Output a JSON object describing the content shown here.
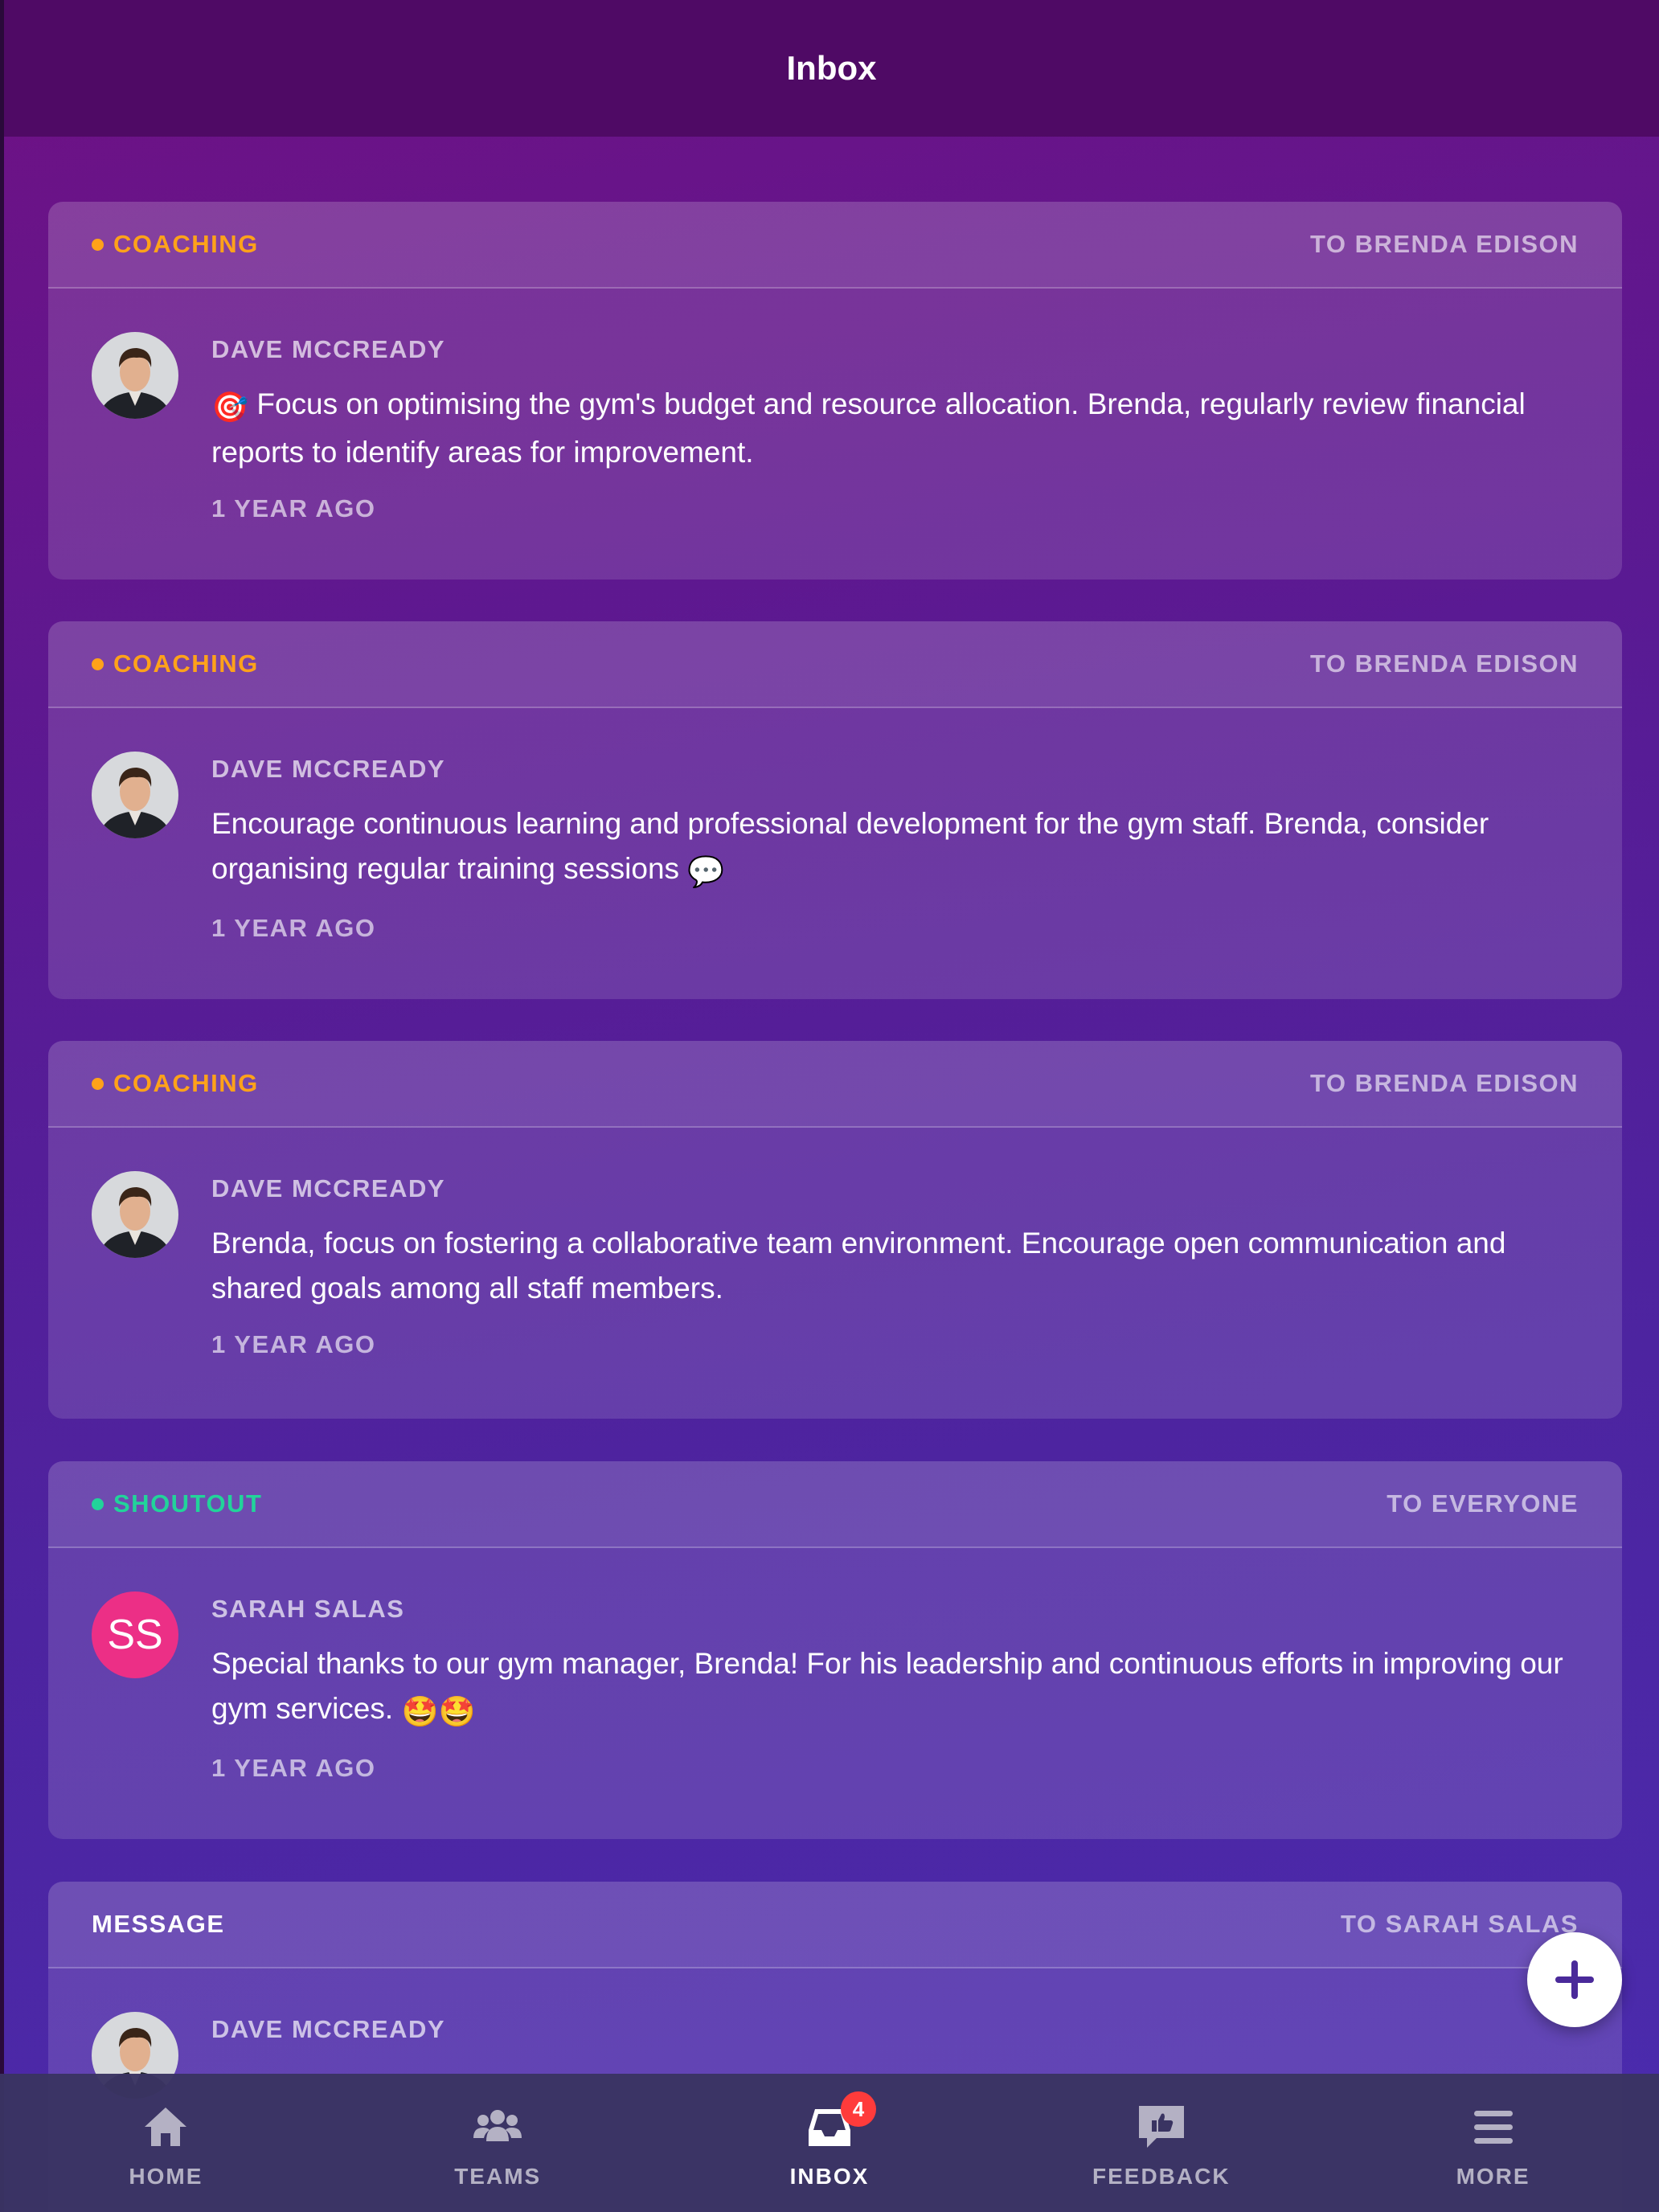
{
  "header": {
    "title": "Inbox"
  },
  "cards": [
    {
      "tag": "COACHING",
      "recipient": "TO BRENDA EDISON",
      "sender": "DAVE MCCREADY",
      "emoji_before": "🎯",
      "text": "Focus on optimising the gym's budget and resource allocation. Brenda, regularly review financial reports to identify areas for improvement.",
      "emoji_after": "",
      "time": "1 YEAR AGO"
    },
    {
      "tag": "COACHING",
      "recipient": "TO BRENDA EDISON",
      "sender": "DAVE MCCREADY",
      "emoji_before": "",
      "text": "Encourage continuous learning and professional development for the gym staff. Brenda, consider organising regular training sessions",
      "emoji_after": "💬",
      "time": "1 YEAR AGO"
    },
    {
      "tag": "COACHING",
      "recipient": "TO BRENDA EDISON",
      "sender": "DAVE MCCREADY",
      "emoji_before": "",
      "text": "Brenda, focus on fostering a collaborative team environment. Encourage open communication and shared goals among all staff members.",
      "emoji_after": "",
      "time": "1 YEAR AGO"
    },
    {
      "tag": "SHOUTOUT",
      "recipient": "TO EVERYONE",
      "sender": "SARAH SALAS",
      "avatar_initials": "SS",
      "emoji_before": "",
      "text": "Special thanks to our gym manager, Brenda! For his leadership and continuous efforts in improving our gym services.",
      "emoji_after": "🤩🤩",
      "time": "1 YEAR AGO"
    },
    {
      "tag": "MESSAGE",
      "recipient": "TO SARAH SALAS",
      "sender": "DAVE MCCREADY"
    }
  ],
  "tabbar": {
    "items": [
      {
        "label": "HOME",
        "icon": "home-icon"
      },
      {
        "label": "TEAMS",
        "icon": "teams-icon"
      },
      {
        "label": "INBOX",
        "icon": "inbox-icon",
        "badge": "4"
      },
      {
        "label": "FEEDBACK",
        "icon": "feedback-icon"
      },
      {
        "label": "MORE",
        "icon": "menu-icon"
      }
    ]
  },
  "colors": {
    "coaching": "#ffa21a",
    "shoutout": "#22d39a",
    "badge": "#ff3b3b",
    "header": "#4f0a65",
    "avatar_ss": "#ec2f86"
  }
}
